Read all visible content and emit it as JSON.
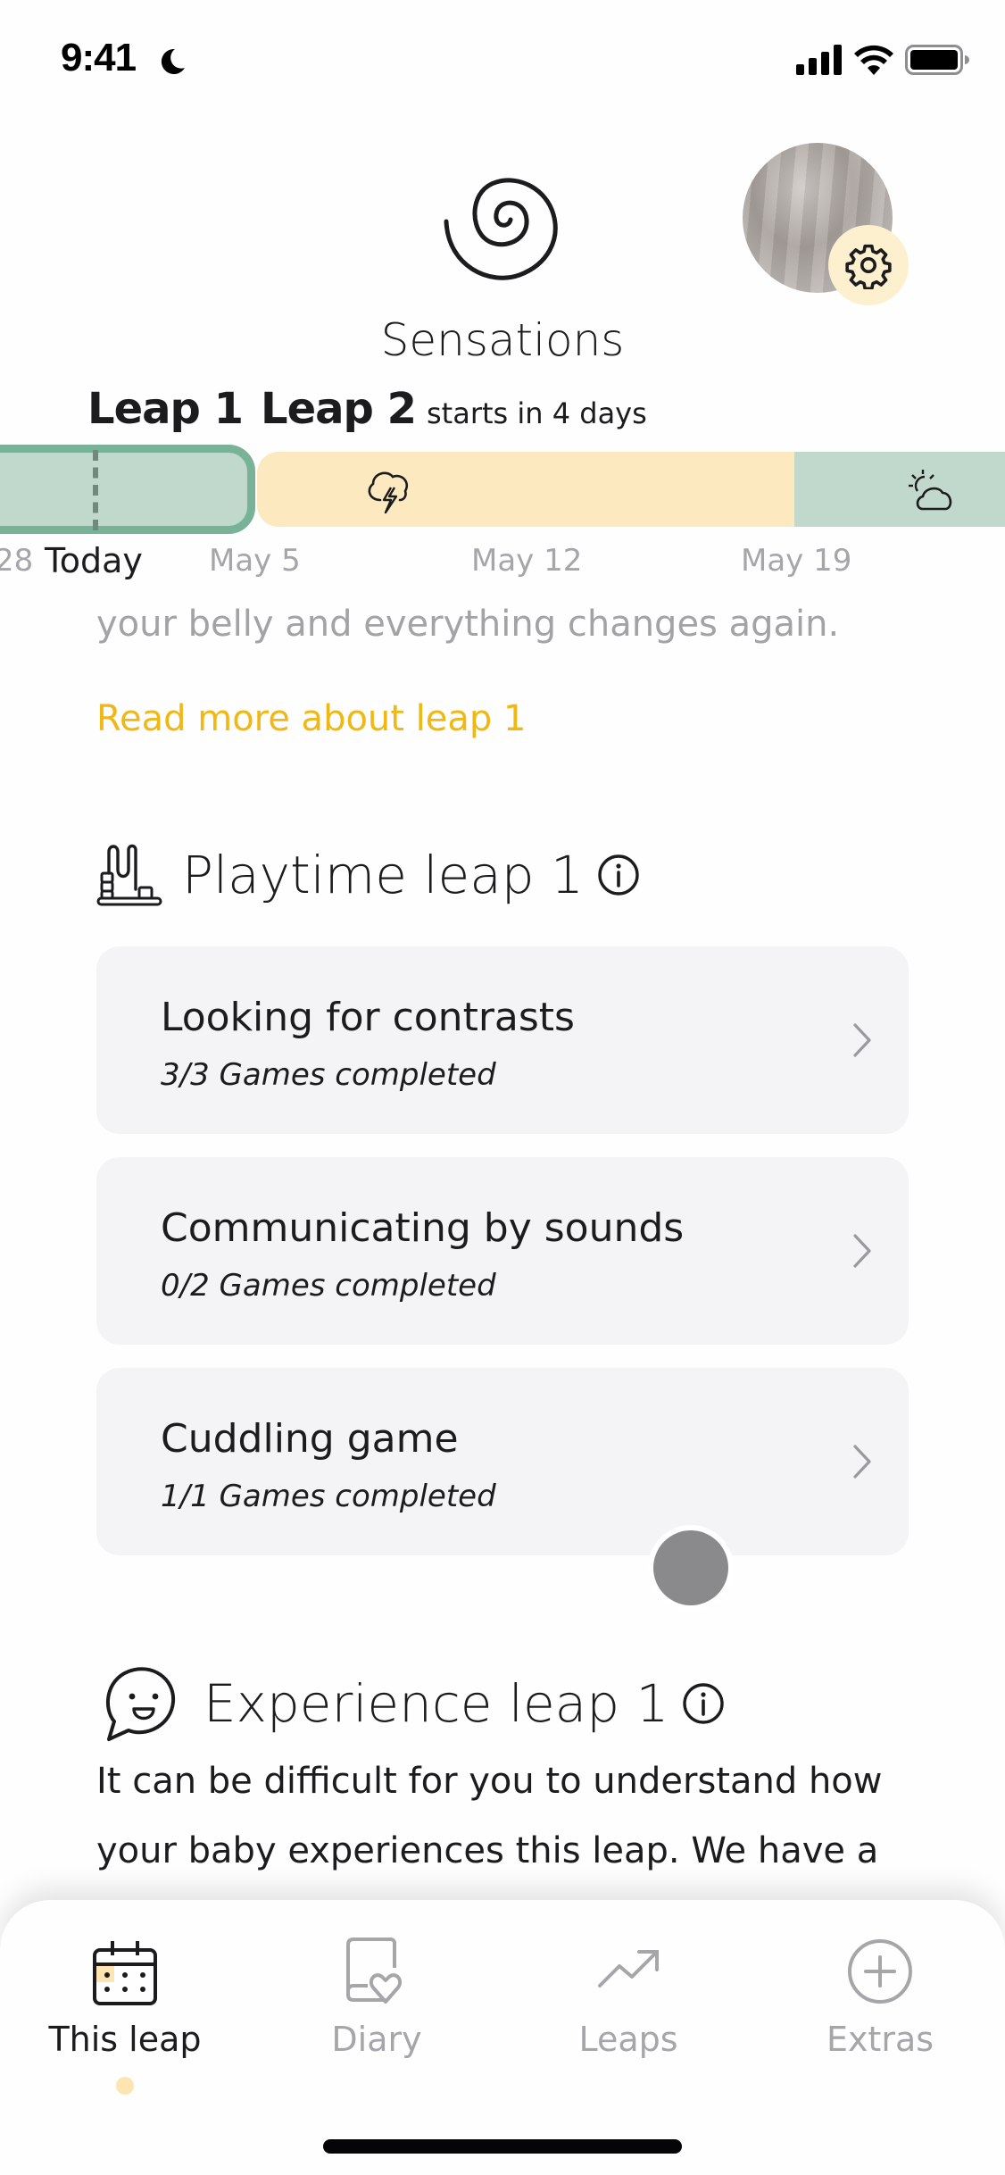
{
  "status_bar": {
    "time": "9:41",
    "focus_icon": "moon-icon",
    "icons": [
      "cellular-signal-icon",
      "wifi-icon",
      "battery-icon"
    ]
  },
  "header": {
    "leap_icon": "spiral-icon",
    "leap_name": "Sensations",
    "avatar": "profile-photo",
    "settings_icon": "gear-icon"
  },
  "leap_header": {
    "current": "Leap 1",
    "next": "Leap 2",
    "next_status": "starts in 4 days"
  },
  "timeline": {
    "segments": [
      {
        "name": "leap-1",
        "type": "current-leap",
        "color": "#c1d8cc",
        "border": "#78b297"
      },
      {
        "name": "leap-2-fussy",
        "type": "stormy",
        "icon": "storm-cloud-icon",
        "color": "#fde9c0"
      },
      {
        "name": "leap-2-sunny",
        "type": "sunny",
        "icon": "sun-cloud-icon",
        "color": "#c1d8cc"
      }
    ],
    "labels": {
      "partial_prev": "28",
      "today": "Today",
      "may5": "May 5",
      "may12": "May 12",
      "may19": "May 19"
    }
  },
  "intro": {
    "faded_line": "your belly and everything changes again.",
    "read_more": "Read more about leap 1",
    "accent_color": "#f0b815"
  },
  "playtime": {
    "icon": "toy-abacus-icon",
    "title": "Playtime leap 1",
    "info_icon": "info-icon",
    "games": [
      {
        "title": "Looking for contrasts",
        "progress": "3/3 Games completed",
        "completed": 3,
        "total": 3
      },
      {
        "title": "Communicating by sounds",
        "progress": "0/2 Games completed",
        "completed": 0,
        "total": 2
      },
      {
        "title": "Cuddling game",
        "progress": "1/1 Games completed",
        "completed": 1,
        "total": 1
      }
    ]
  },
  "experience": {
    "icon": "smiley-speech-bubble-icon",
    "title": "Experience leap 1",
    "info_icon": "info-icon",
    "lines": [
      "It can be difficult for you to understand how",
      "your baby experiences this leap. We have a"
    ]
  },
  "tabbar": {
    "active": "This leap",
    "tabs": [
      {
        "label": "This leap",
        "icon": "calendar-icon"
      },
      {
        "label": "Diary",
        "icon": "diary-heart-icon"
      },
      {
        "label": "Leaps",
        "icon": "trend-up-icon"
      },
      {
        "label": "Extras",
        "icon": "plus-circle-icon"
      }
    ]
  }
}
